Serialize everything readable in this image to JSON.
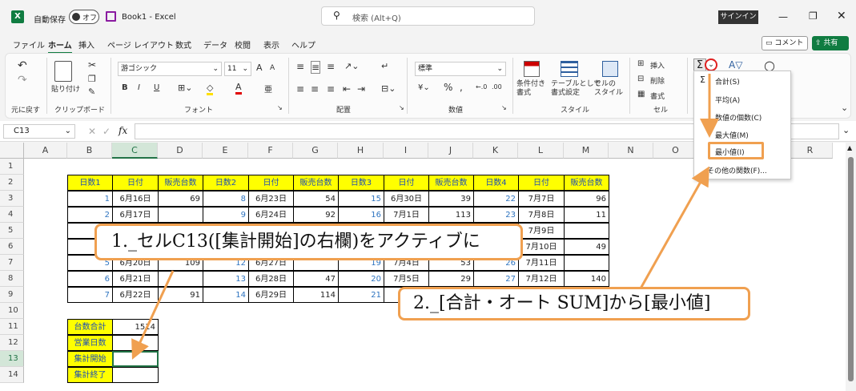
{
  "title": {
    "autosave_label": "自動保存",
    "autosave_state": "オフ",
    "doc_title": "Book1 - Excel",
    "search_placeholder": "検索 (Alt+Q)",
    "signin": "サインイン"
  },
  "menu": [
    "ファイル",
    "ホーム",
    "挿入",
    "ページ レイアウト",
    "数式",
    "データ",
    "校閲",
    "表示",
    "ヘルプ"
  ],
  "menu_right": {
    "comment": "コメント",
    "share": "共有"
  },
  "ribbon": {
    "undo_group": "元に戻す",
    "clipboard_group": "クリップボード",
    "paste": "貼り付け",
    "font_group": "フォント",
    "font_name": "游ゴシック",
    "font_size": "11",
    "align_group": "配置",
    "number_group": "数値",
    "number_format": "標準",
    "style_group": "スタイル",
    "cells_group": "セル",
    "bold": "B",
    "italic": "I",
    "underline": "U",
    "grow": "A",
    "shrink": "A",
    "percent": "%",
    "cond_format": "条件付き\n書式",
    "table_format": "テーブルとして\n書式設定",
    "cell_style": "セルの\nスタイル",
    "insert": "挿入",
    "delete": "削除",
    "format": "書式"
  },
  "formula_bar": {
    "name_box": "C13",
    "fx": "fx",
    "value": ""
  },
  "columns": [
    "A",
    "B",
    "C",
    "D",
    "E",
    "F",
    "G",
    "H",
    "I",
    "J",
    "K",
    "L",
    "M",
    "N",
    "O",
    "P",
    "Q",
    "R"
  ],
  "rows": [
    "1",
    "2",
    "3",
    "4",
    "5",
    "6",
    "7",
    "8",
    "9",
    "10",
    "11",
    "12",
    "13",
    "14"
  ],
  "table": {
    "headers": [
      "日数1",
      "日付",
      "販売台数",
      "日数2",
      "日付",
      "販売台数",
      "日数3",
      "日付",
      "販売台数",
      "日数4",
      "日付",
      "販売台数"
    ],
    "r3": [
      "1",
      "6月16日",
      "69",
      "8",
      "6月23日",
      "54",
      "15",
      "6月30日",
      "39",
      "22",
      "7月7日",
      "96"
    ],
    "r4": [
      "2",
      "6月17日",
      "",
      "9",
      "6月24日",
      "92",
      "16",
      "7月1日",
      "113",
      "23",
      "7月8日",
      "11"
    ],
    "r5": [
      "",
      "",
      "",
      "",
      "",
      "",
      "",
      "",
      "",
      "",
      "7月9日",
      ""
    ],
    "r6": [
      "",
      "",
      "",
      "",
      "",
      "",
      "",
      "",
      "",
      "",
      "7月10日",
      "49"
    ],
    "r7": [
      "5",
      "6月20日",
      "109",
      "12",
      "6月27日",
      "",
      "19",
      "7月4日",
      "53",
      "26",
      "7月11日",
      ""
    ],
    "r8": [
      "6",
      "6月21日",
      "",
      "13",
      "6月28日",
      "47",
      "20",
      "7月5日",
      "29",
      "27",
      "7月12日",
      "140"
    ],
    "r9": [
      "7",
      "6月22日",
      "91",
      "14",
      "6月29日",
      "114",
      "21",
      "",
      "",
      "",
      "",
      ""
    ]
  },
  "summary": {
    "labels": [
      "台数合計",
      "営業日数",
      "集計開始",
      "集計終了"
    ],
    "total": "1514"
  },
  "dropdown": [
    "合計(S)",
    "平均(A)",
    "数値の個数(C)",
    "最大値(M)",
    "最小値(I)",
    "その他の関数(F)..."
  ],
  "callouts": {
    "c1": "1._セルC13([集計開始]の右欄)をアクティブに",
    "c2": "2._[合計・オート SUM]から[最小値]"
  },
  "colors": {
    "accent": "#f0a050",
    "excel_green": "#107c41",
    "header_fill": "#ffff00",
    "selection": "#217346"
  }
}
